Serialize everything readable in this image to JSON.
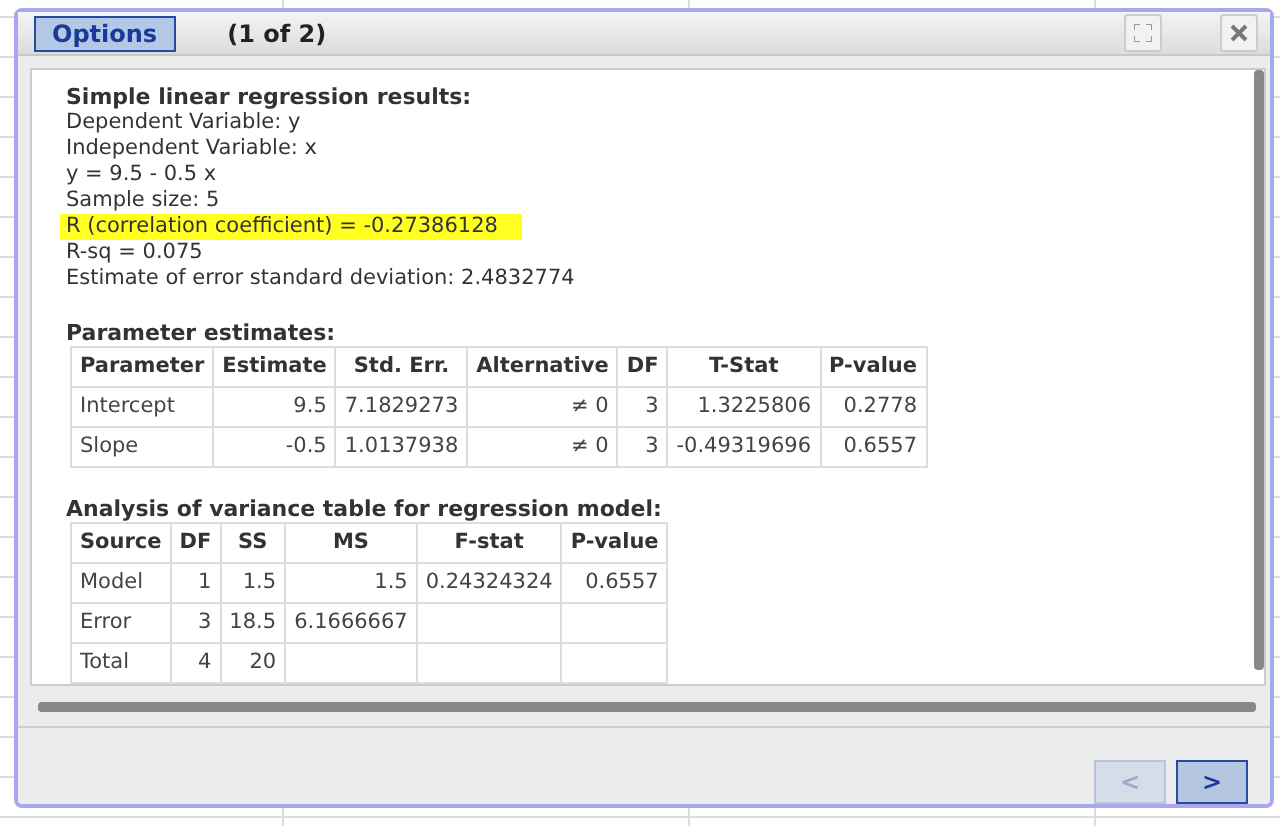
{
  "dialog": {
    "options_button": "Options",
    "page_indicator": "(1 of 2)"
  },
  "summary": {
    "heading": "Simple linear regression results:",
    "lines": [
      {
        "text": "Dependent Variable: y",
        "highlighted": false
      },
      {
        "text": "Independent Variable: x",
        "highlighted": false
      },
      {
        "text": "y = 9.5 - 0.5 x",
        "highlighted": false
      },
      {
        "text": "Sample size: 5",
        "highlighted": false
      },
      {
        "text": "R (correlation coefficient) = -0.27386128",
        "highlighted": true
      },
      {
        "text": "R-sq = 0.075",
        "highlighted": false
      },
      {
        "text": "Estimate of error standard deviation: 2.4832774",
        "highlighted": false
      }
    ]
  },
  "tables": [
    {
      "title": "Parameter estimates:",
      "columns": [
        "Parameter",
        "Estimate",
        "Std. Err.",
        "Alternative",
        "DF",
        "T-Stat",
        "P-value"
      ],
      "rows": [
        [
          "Intercept",
          "9.5",
          "7.1829273",
          "≠ 0",
          "3",
          "1.3225806",
          "0.2778"
        ],
        [
          "Slope",
          "-0.5",
          "1.0137938",
          "≠ 0",
          "3",
          "-0.49319696",
          "0.6557"
        ]
      ]
    },
    {
      "title": "Analysis of variance table for regression model:",
      "columns": [
        "Source",
        "DF",
        "SS",
        "MS",
        "F-stat",
        "P-value"
      ],
      "rows": [
        [
          "Model",
          "1",
          "1.5",
          "1.5",
          "0.24324324",
          "0.6557"
        ],
        [
          "Error",
          "3",
          "18.5",
          "6.1666667",
          "",
          ""
        ],
        [
          "Total",
          "4",
          "20",
          "",
          "",
          ""
        ]
      ]
    }
  ],
  "footer": {
    "buttons": [
      {
        "label": "<",
        "disabled": true
      },
      {
        "label": ">",
        "disabled": false
      }
    ]
  }
}
